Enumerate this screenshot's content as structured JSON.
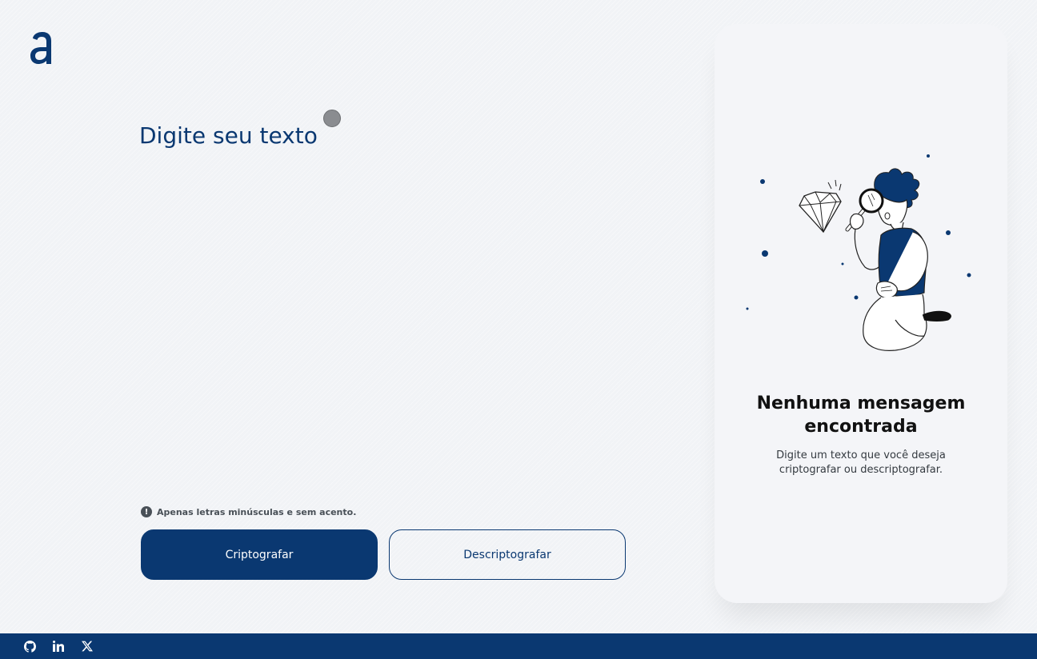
{
  "app": {
    "logo_icon": "alura-a-logo-icon",
    "brand_color": "#0a3871"
  },
  "editor": {
    "placeholder": "Digite seu texto",
    "value": ""
  },
  "hint": {
    "icon": "exclamation-circle-icon",
    "text": "Apenas letras minúsculas e sem acento."
  },
  "actions": {
    "encrypt_label": "Criptografar",
    "decrypt_label": "Descriptografar"
  },
  "result": {
    "illustration": "person-inspecting-diamond-with-magnifier",
    "title": "Nenhuma mensagem encontrada",
    "subtitle": "Digite um texto que você deseja criptografar ou descriptografar."
  },
  "footer": {
    "links": [
      {
        "icon": "github-icon"
      },
      {
        "icon": "linkedin-icon"
      },
      {
        "icon": "x-twitter-icon"
      }
    ]
  }
}
